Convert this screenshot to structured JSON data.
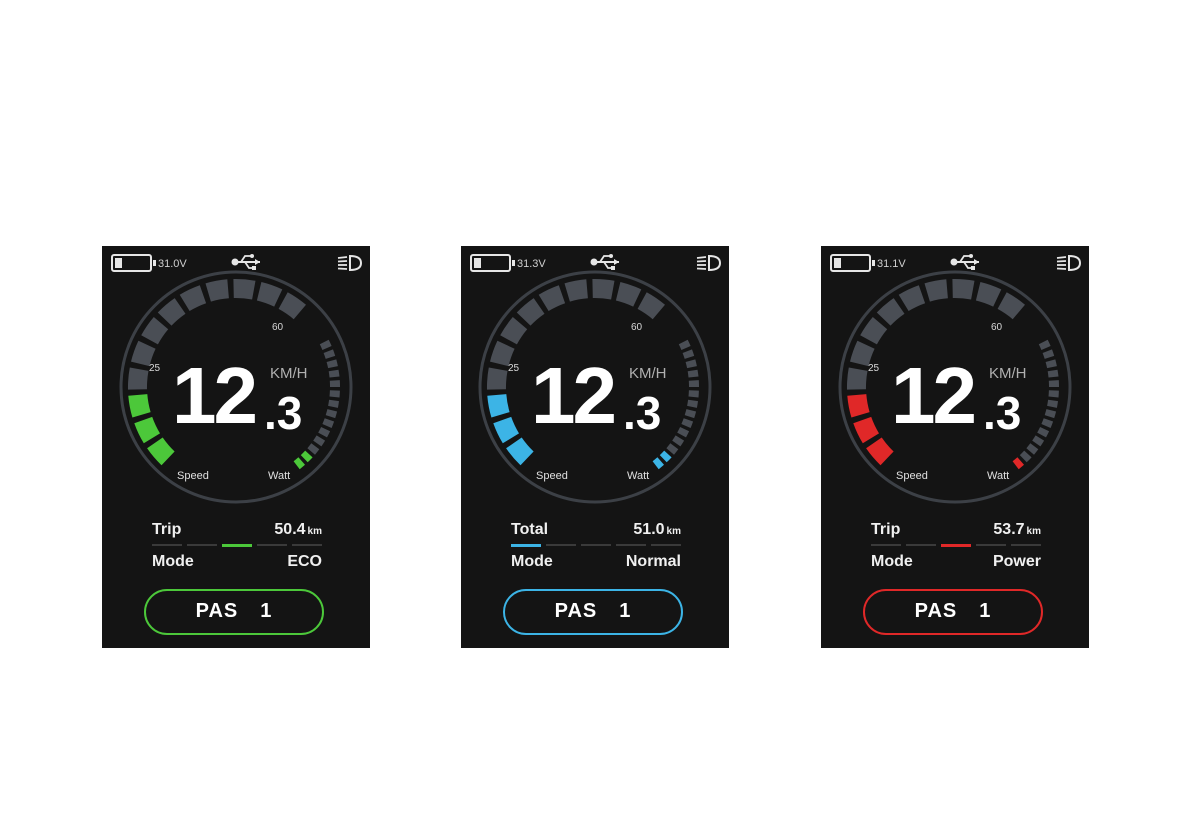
{
  "displays": [
    {
      "voltage": "31.0V",
      "tick_60": "60",
      "tick_25": "25",
      "speed_int": "12",
      "speed_dec": ".3",
      "speed_unit": "KM/H",
      "label_speed": "Speed",
      "label_watt": "Watt",
      "row1_label": "Trip",
      "row1_value": "50.4",
      "row1_unit": "km",
      "row2_label": "Mode",
      "row2_value": "ECO",
      "pas_label": "PAS",
      "pas_level": "1",
      "accent": "#4cc83a",
      "speed_segments_lit": 3,
      "watt_segments_lit": 2,
      "mode_index": 2,
      "battery_icon": "battery-icon",
      "usb_icon": "usb-icon",
      "light_icon": "headlight-icon"
    },
    {
      "voltage": "31.3V",
      "tick_60": "60",
      "tick_25": "25",
      "speed_int": "12",
      "speed_dec": ".3",
      "speed_unit": "KM/H",
      "label_speed": "Speed",
      "label_watt": "Watt",
      "row1_label": "Total",
      "row1_value": "51.0",
      "row1_unit": "km",
      "row2_label": "Mode",
      "row2_value": "Normal",
      "pas_label": "PAS",
      "pas_level": "1",
      "accent": "#3cb4e6",
      "speed_segments_lit": 3,
      "watt_segments_lit": 2,
      "mode_index": 0,
      "battery_icon": "battery-icon",
      "usb_icon": "usb-icon",
      "light_icon": "headlight-icon"
    },
    {
      "voltage": "31.1V",
      "tick_60": "60",
      "tick_25": "25",
      "speed_int": "12",
      "speed_dec": ".3",
      "speed_unit": "KM/H",
      "label_speed": "Speed",
      "label_watt": "Watt",
      "row1_label": "Trip",
      "row1_value": "53.7",
      "row1_unit": "km",
      "row2_label": "Mode",
      "row2_value": "Power",
      "pas_label": "PAS",
      "pas_level": "1",
      "accent": "#e02828",
      "speed_segments_lit": 3,
      "watt_segments_lit": 1,
      "mode_index": 2,
      "battery_icon": "battery-icon",
      "usb_icon": "usb-icon",
      "light_icon": "headlight-icon"
    }
  ]
}
